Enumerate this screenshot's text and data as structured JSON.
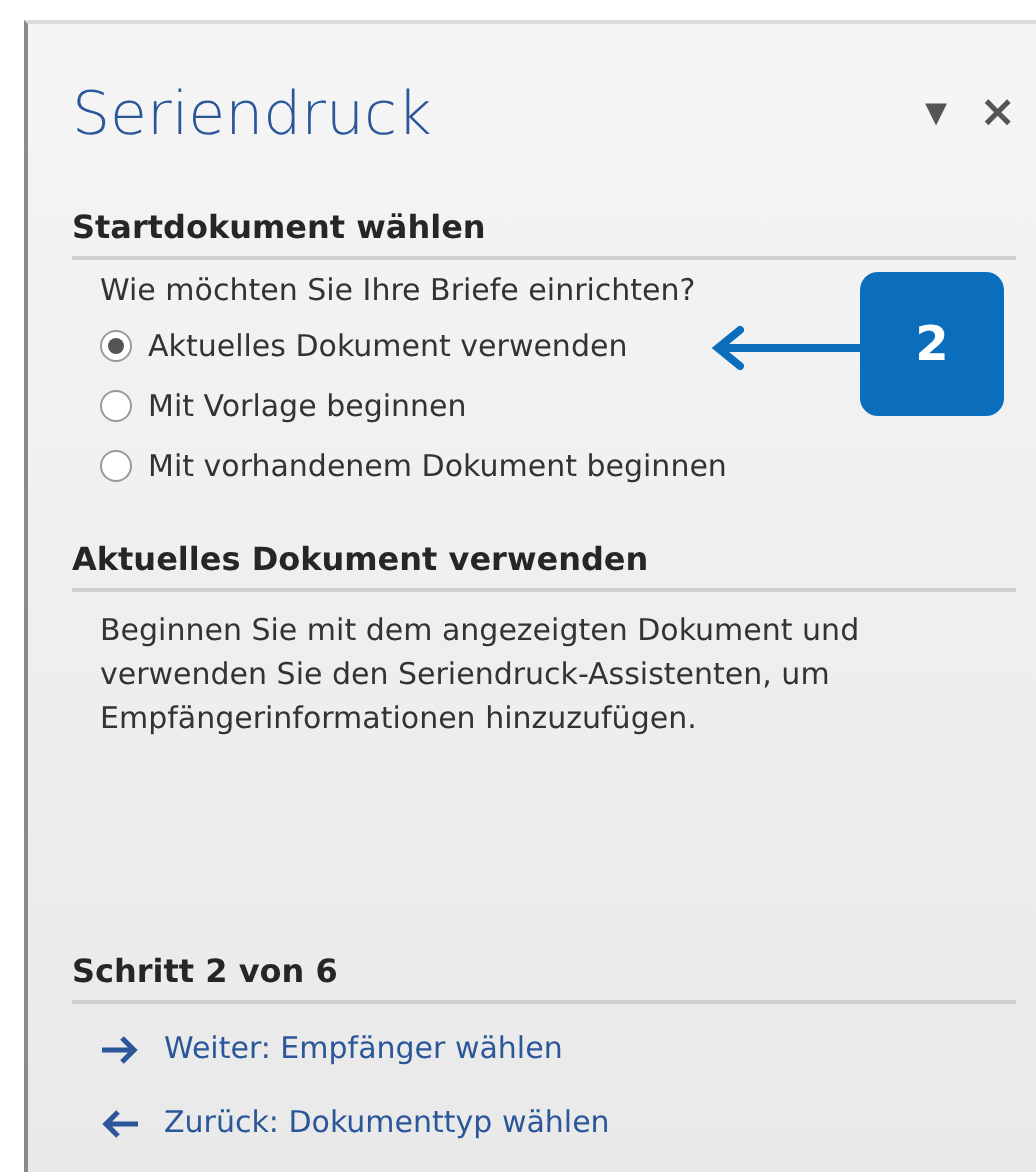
{
  "panel": {
    "title": "Seriendruck",
    "menu_glyph": "▾",
    "close_glyph": "×"
  },
  "start_section": {
    "heading": "Startdokument wählen",
    "question": "Wie möchten Sie Ihre Briefe einrichten?",
    "options": [
      {
        "label": "Aktuelles Dokument verwenden",
        "selected": true
      },
      {
        "label": "Mit Vorlage beginnen",
        "selected": false
      },
      {
        "label": "Mit vorhandenem Dokument beginnen",
        "selected": false
      }
    ]
  },
  "info_section": {
    "heading": "Aktuelles Dokument verwenden",
    "text": "Beginnen Sie mit dem angezeigten Dokument und verwenden Sie den Seriendruck-Assistenten, um Empfängerinformationen hinzuzufügen."
  },
  "step_section": {
    "heading": "Schritt 2 von 6",
    "links": [
      {
        "kind": "next",
        "label": "Weiter: Empfänger wählen"
      },
      {
        "kind": "back",
        "label": "Zurück: Dokumenttyp wählen"
      }
    ]
  },
  "callout": {
    "label": "2"
  }
}
